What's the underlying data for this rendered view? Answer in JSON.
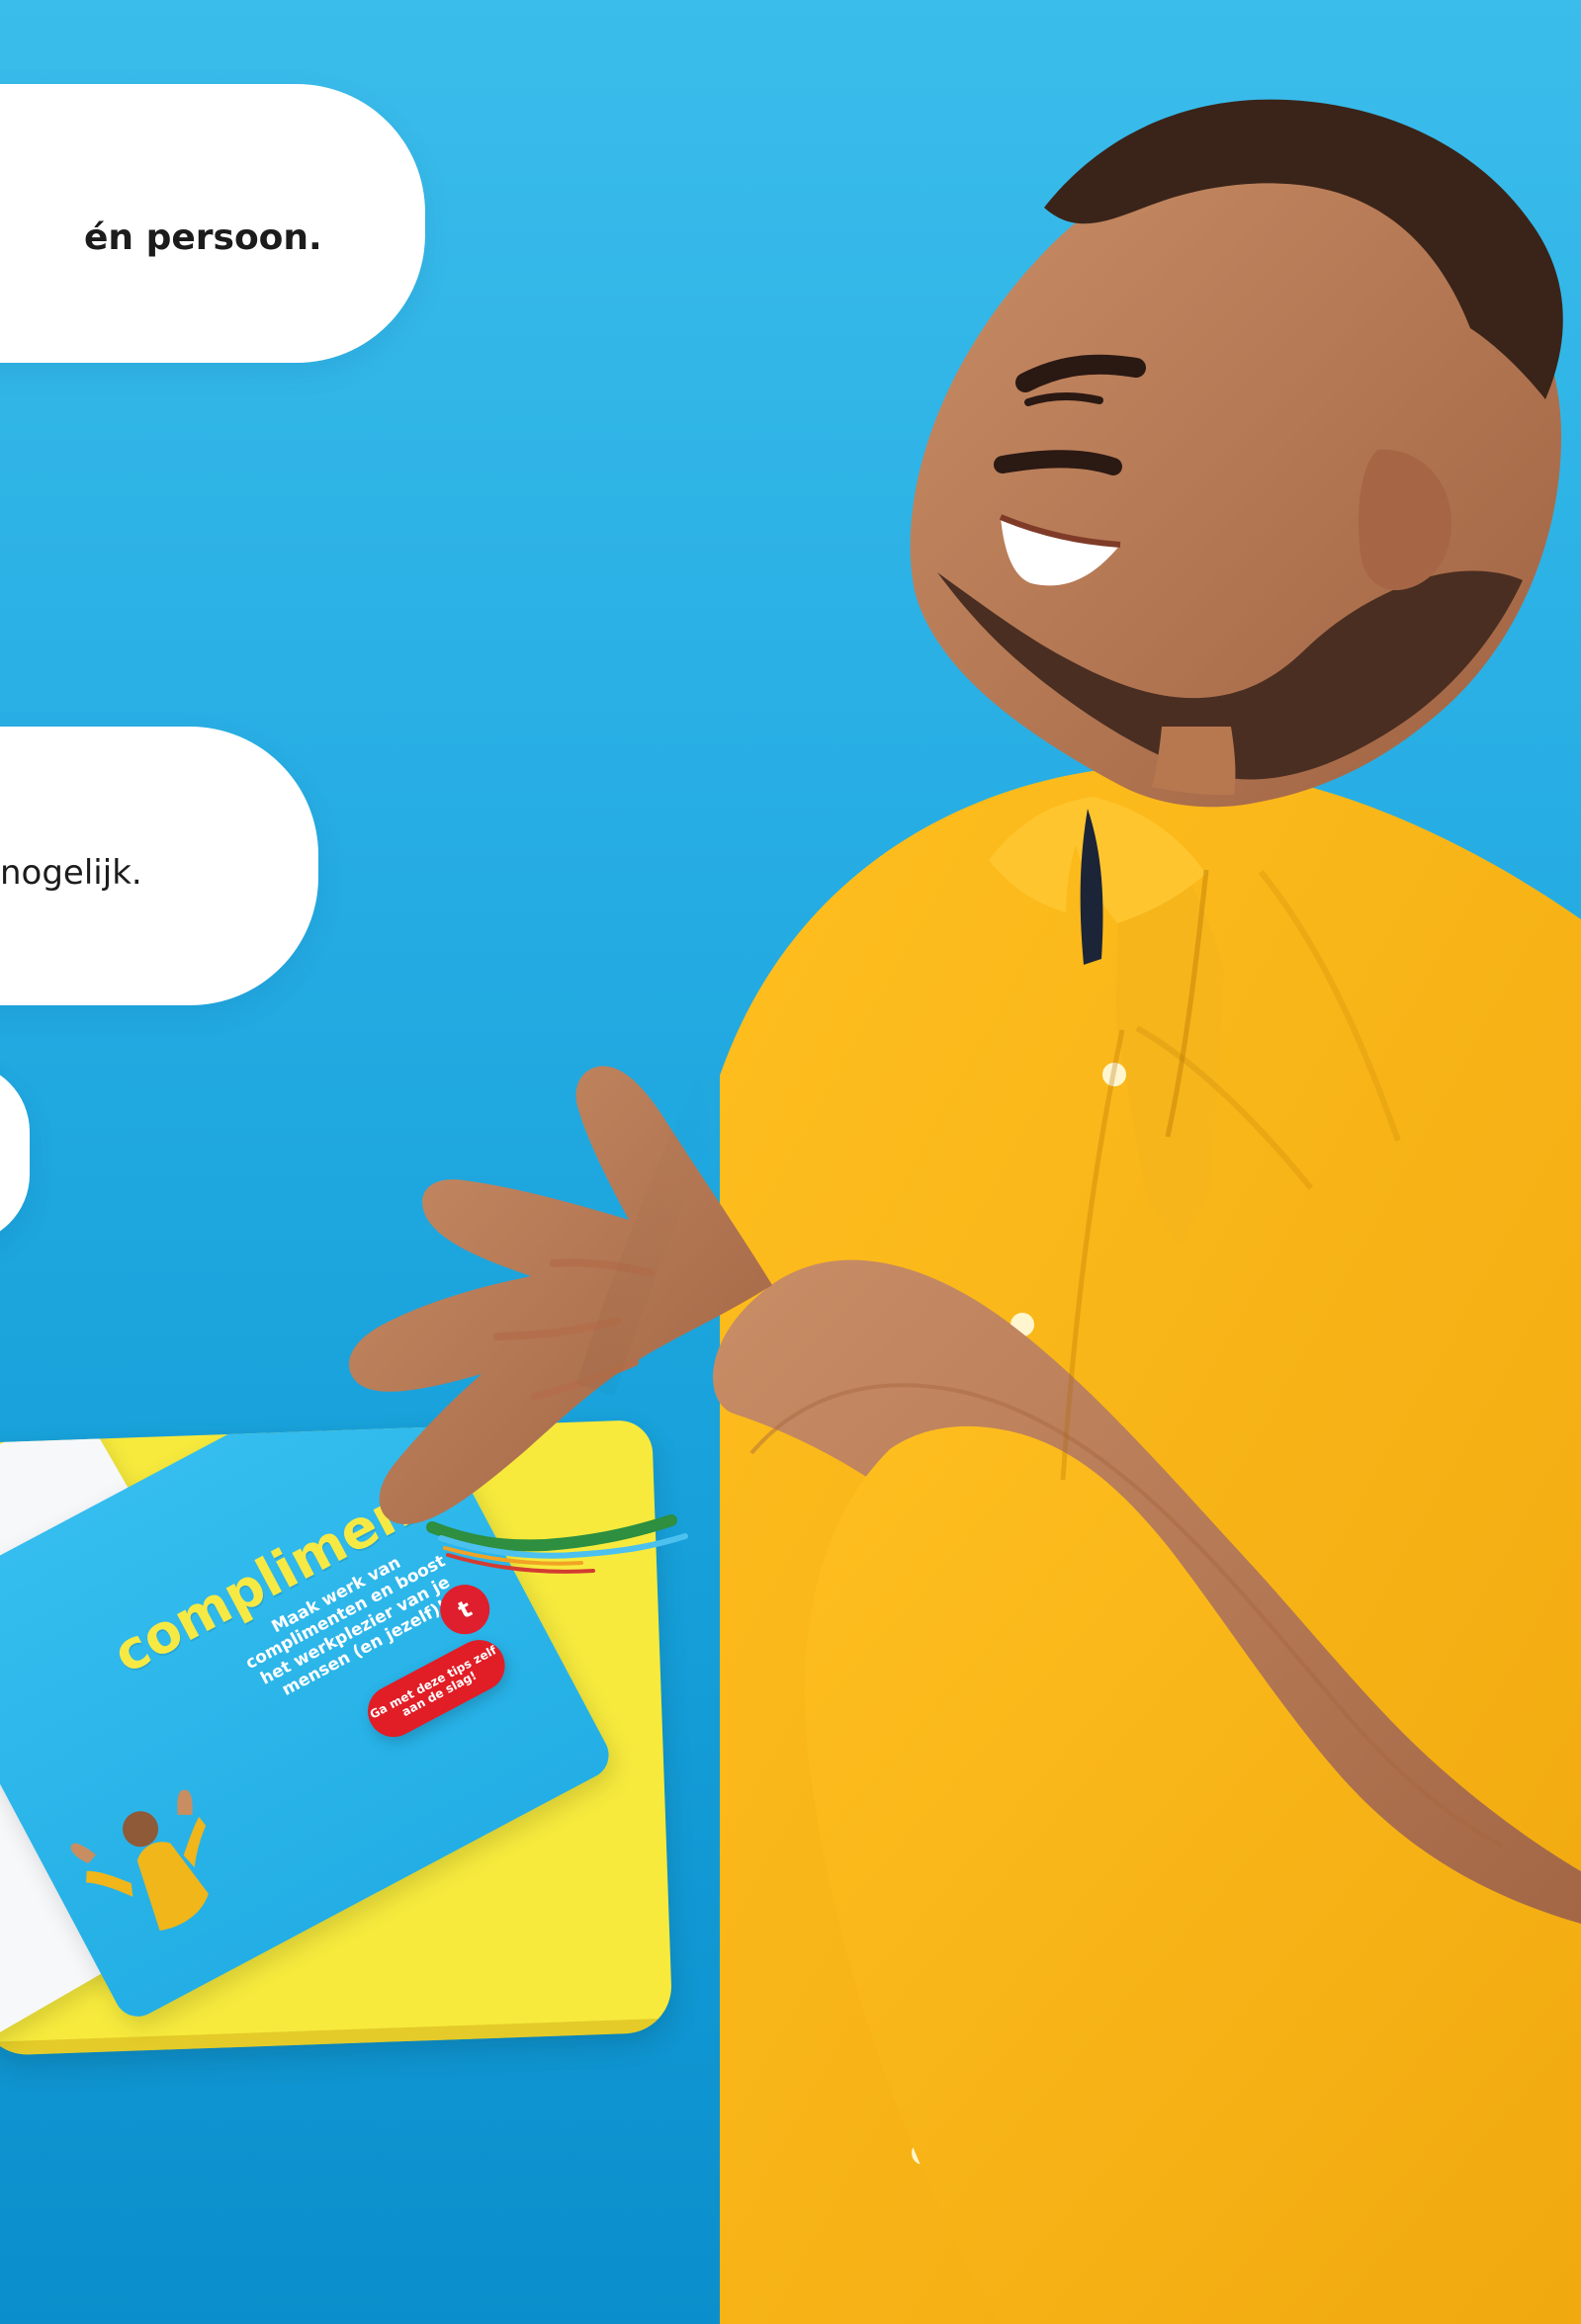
{
  "bubbles": [
    {
      "text": "én persoon."
    },
    {
      "text": "nogelijk."
    },
    {
      "text": ""
    }
  ],
  "guide": {
    "title": "complimentengids",
    "subtitle": "Maak werk van complimenten en boost het werkplezier van je mensen (en jezelf)!",
    "cta": "Ga met deze tips zelf aan de slag!",
    "logo": "t"
  },
  "colors": {
    "background_top": "#3bbdeb",
    "background_bottom": "#0b8fcc",
    "bubble": "#ffffff",
    "shirt": "#f5b21a",
    "card": "#f7ea3d",
    "cta": "#e11d26"
  }
}
